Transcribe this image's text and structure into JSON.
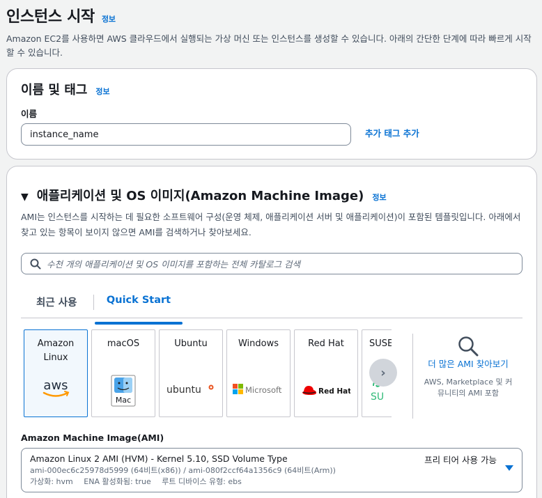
{
  "header": {
    "title": "인스턴스 시작",
    "info": "정보",
    "description": "Amazon EC2를 사용하면 AWS 클라우드에서 실행되는 가상 머신 또는 인스턴스를 생성할 수 있습니다. 아래의 간단한 단계에 따라 빠르게 시작할 수 있습니다."
  },
  "name_tags": {
    "title": "이름 및 태그",
    "info": "정보",
    "name_label": "이름",
    "name_value": "instance_name",
    "add_tag": "추가 태그 추가"
  },
  "ami_section": {
    "title": "애플리케이션 및 OS 이미지(Amazon Machine Image)",
    "info": "정보",
    "description": "AMI는 인스턴스를 시작하는 데 필요한 소프트웨어 구성(운영 체제, 애플리케이션 서버 및 애플리케이션)이 포함된 템플릿입니다. 아래에서 찾고 있는 항목이 보이지 않으면 AMI를 검색하거나 찾아보세요.",
    "search_placeholder": "수천 개의 애플리케이션 및 OS 이미지를 포함하는 전체 카탈로그 검색",
    "tabs": [
      {
        "label": "최근 사용",
        "active": false
      },
      {
        "label": "Quick Start",
        "active": true
      }
    ],
    "tiles": [
      {
        "name": "Amazon\nLinux",
        "logo": "aws",
        "selected": true
      },
      {
        "name": "macOS",
        "logo": "Mac",
        "selected": false
      },
      {
        "name": "Ubuntu",
        "logo": "ubuntu",
        "selected": false
      },
      {
        "name": "Windows",
        "logo": "Microsoft",
        "selected": false
      },
      {
        "name": "Red Hat",
        "logo": "Red Hat",
        "selected": false
      },
      {
        "name": "SUSE",
        "logo": "SU",
        "selected": false
      }
    ],
    "more": {
      "title": "더 많은 AMI 찾아보기",
      "subtitle": "AWS, Marketplace 및 커뮤니티의 AMI 포함"
    },
    "ami_label": "Amazon Machine Image(AMI)",
    "selected_ami": {
      "name": "Amazon Linux 2 AMI (HVM) - Kernel 5.10, SSD Volume Type",
      "ids": "ami-000ec6c25978d5999 (64비트(x86)) / ami-080f2ccf64a1356c9 (64비트(Arm))",
      "virtualization": "가상화: hvm",
      "ena": "ENA 활성화됨: true",
      "root_device": "루트 디바이스 유형: ebs",
      "free_tier": "프리 티어 사용 가능"
    }
  },
  "colors": {
    "accent": "#0972d3",
    "aws_orange": "#ff9900",
    "ubuntu_orange": "#e95420",
    "redhat_red": "#ee0000",
    "suse_green": "#30ba78"
  }
}
